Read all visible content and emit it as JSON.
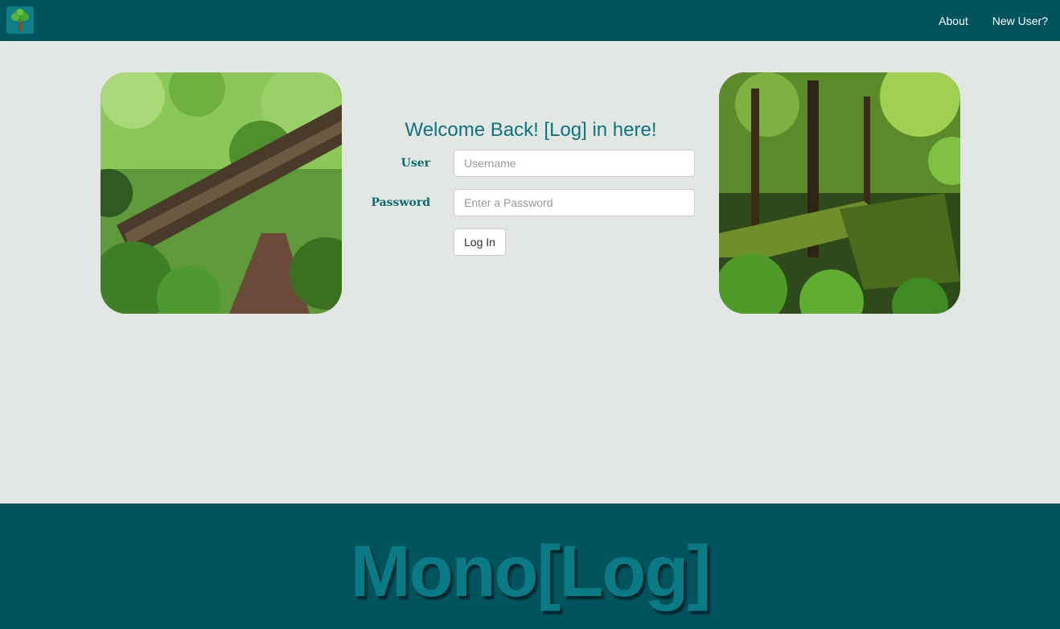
{
  "nav": {
    "logo_icon": "tree-icon",
    "links": [
      {
        "label": "About"
      },
      {
        "label": "New User?"
      }
    ]
  },
  "login": {
    "title": "Welcome Back! [Log] in here!",
    "user_label": "User",
    "user_placeholder": "Username",
    "user_value": "",
    "password_label": "Password",
    "password_placeholder": "Enter a Password",
    "password_value": "",
    "submit_label": "Log In"
  },
  "images": {
    "left": "forest-fallen-log-photo",
    "right": "mossy-rainforest-photo"
  },
  "footer": {
    "brand": "Mono[Log]"
  },
  "colors": {
    "navbar": "#00545e",
    "background": "#e3e7e3",
    "accent": "#0b7481"
  }
}
